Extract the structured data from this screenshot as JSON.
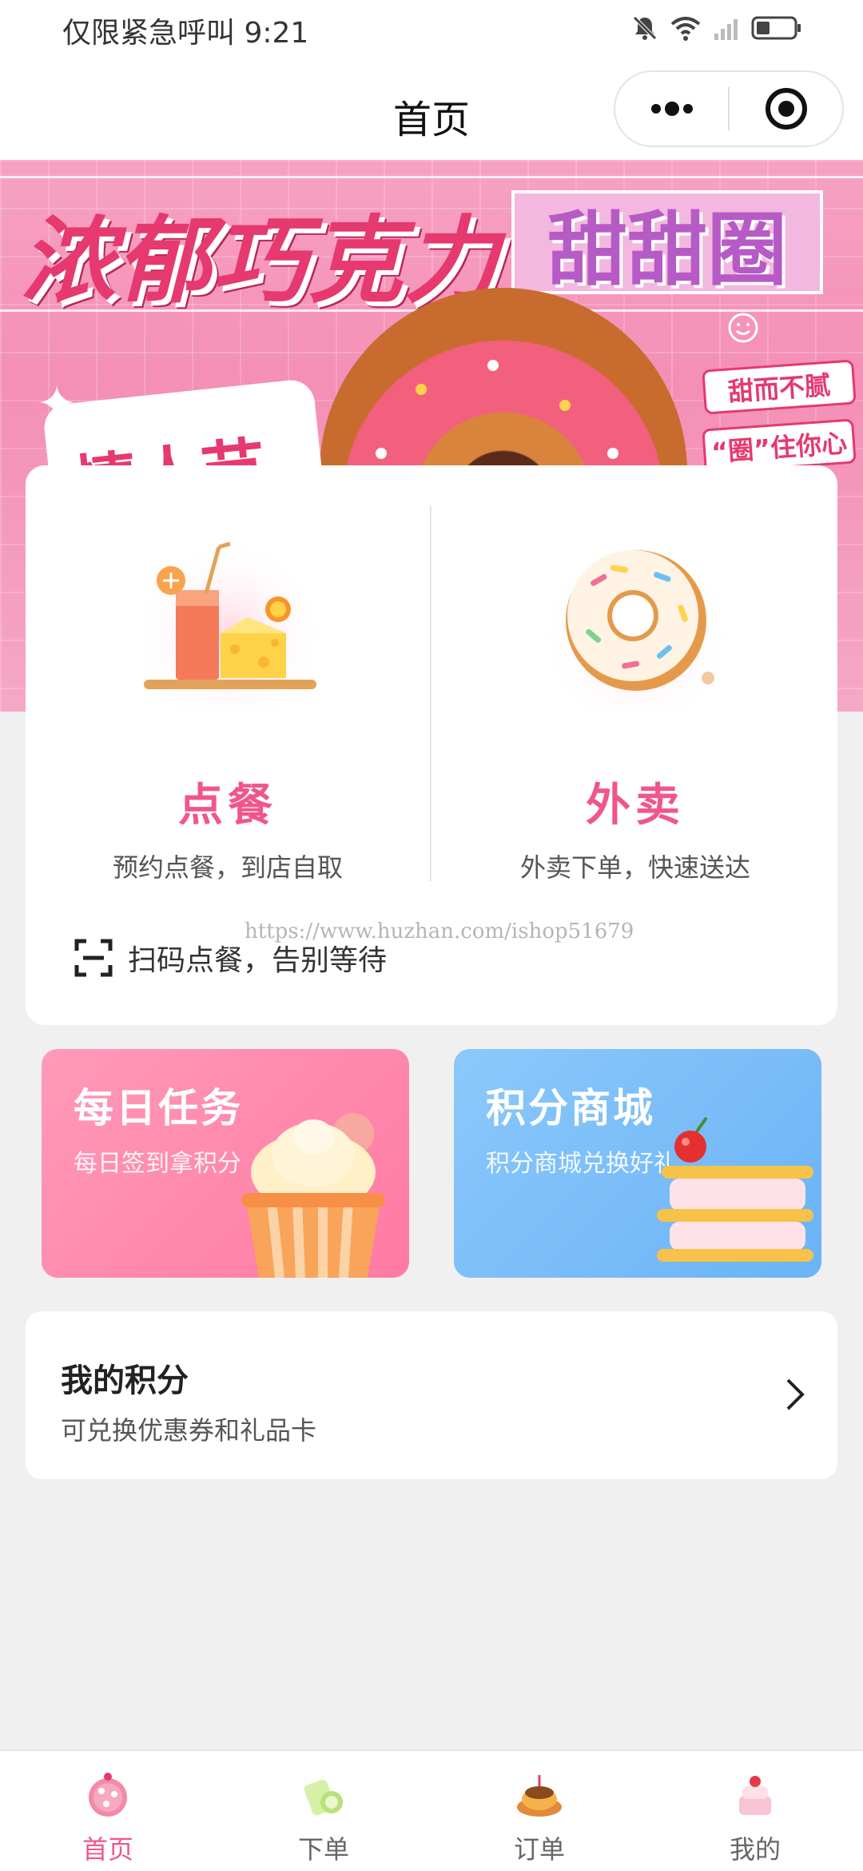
{
  "status_bar": {
    "left_text": "仅限紧急呼叫 9:21",
    "icons": [
      "bell-muted-icon",
      "wifi-icon",
      "signal-icon",
      "battery-icon"
    ]
  },
  "navbar": {
    "title": "首页",
    "capsule": {
      "icons": [
        "more-icon",
        "close-target-icon"
      ]
    }
  },
  "banner": {
    "headline": "浓郁巧克力",
    "tag": "甜甜圈",
    "event": "情人节",
    "slogans": [
      "甜而不腻",
      "“圈”住你心"
    ]
  },
  "order_options": [
    {
      "title": "点餐",
      "desc": "预约点餐，到店自取",
      "icon": "drink-cheese-icon"
    },
    {
      "title": "外卖",
      "desc": "外卖下单，快速送达",
      "icon": "donut-icon"
    }
  ],
  "scan": {
    "text": "扫码点餐，告别等待",
    "icon": "scan-icon"
  },
  "watermark": "https://www.huzhan.com/ishop51679",
  "tiles": [
    {
      "title": "每日任务",
      "desc": "每日签到拿积分",
      "color": "#ff8fb0"
    },
    {
      "title": "积分商城",
      "desc": "积分商城兑换好礼",
      "color": "#7cbcf8"
    }
  ],
  "points": {
    "title": "我的积分",
    "desc": "可兑换优惠券和礼品卡"
  },
  "tabbar": [
    {
      "label": "首页",
      "active": true
    },
    {
      "label": "下单",
      "active": false
    },
    {
      "label": "订单",
      "active": false
    },
    {
      "label": "我的",
      "active": false
    }
  ],
  "colors": {
    "accent": "#f0568b",
    "background": "#f0f0f0"
  }
}
